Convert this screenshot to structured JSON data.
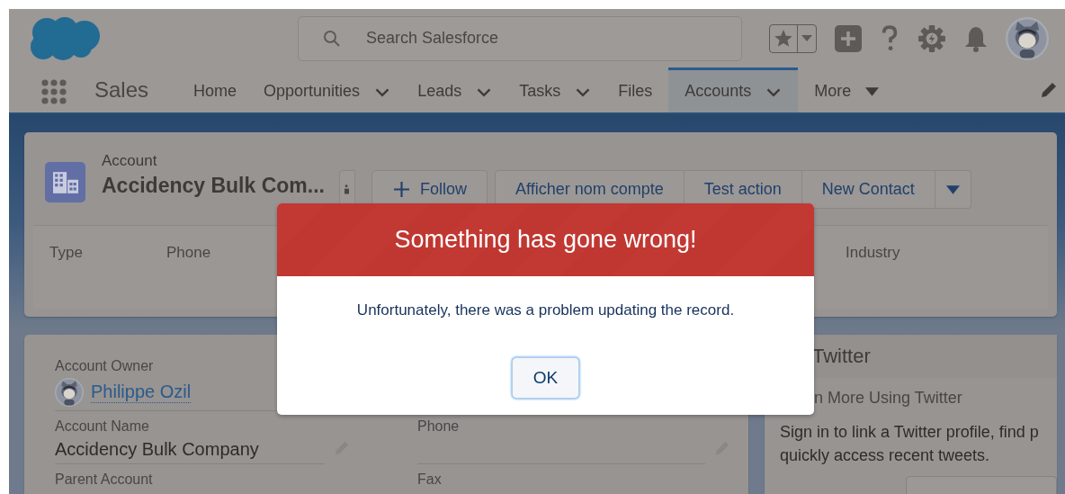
{
  "header": {
    "search": {
      "placeholder": "Search Salesforce"
    }
  },
  "nav": {
    "app_name": "Sales",
    "tabs": [
      {
        "label": "Home",
        "selected": false,
        "kind": "plain"
      },
      {
        "label": "Opportunities",
        "selected": false,
        "kind": "dropdown"
      },
      {
        "label": "Leads",
        "selected": false,
        "kind": "dropdown"
      },
      {
        "label": "Tasks",
        "selected": false,
        "kind": "dropdown"
      },
      {
        "label": "Files",
        "selected": false,
        "kind": "plain"
      },
      {
        "label": "Accounts",
        "selected": true,
        "kind": "dropdown"
      },
      {
        "label": "More",
        "selected": false,
        "kind": "more"
      }
    ]
  },
  "record": {
    "object_type": "Account",
    "title": "Accidency Bulk Com...",
    "actions": [
      {
        "label": "Follow",
        "kind": "follow"
      },
      {
        "label": "Afficher nom compte",
        "kind": "group"
      },
      {
        "label": "Test action",
        "kind": "group"
      },
      {
        "label": "New Contact",
        "kind": "group"
      }
    ],
    "highlights": [
      {
        "label": "Type"
      },
      {
        "label": "Phone"
      },
      {
        "label": "Industry"
      }
    ]
  },
  "details": {
    "rows": [
      [
        {
          "label": "Account Owner",
          "value": "Philippe Ozil",
          "kind": "user"
        }
      ],
      [
        {
          "label": "Account Name",
          "value": "Accidency Bulk Company",
          "kind": "text",
          "editable": true
        },
        {
          "label": "Phone",
          "kind": "text",
          "editable": true
        }
      ],
      [
        {
          "label": "Parent Account",
          "kind": "text"
        },
        {
          "label": "Fax",
          "kind": "text"
        }
      ]
    ]
  },
  "twitter": {
    "title": "Twitter",
    "subtitle": "n More Using Twitter",
    "lines": [
      "Sign in to link a Twitter profile, find p",
      "quickly access recent tweets."
    ]
  },
  "modal": {
    "title": "Something has gone wrong!",
    "message": "Unfortunately, there was a problem updating the record.",
    "button": "OK"
  }
}
